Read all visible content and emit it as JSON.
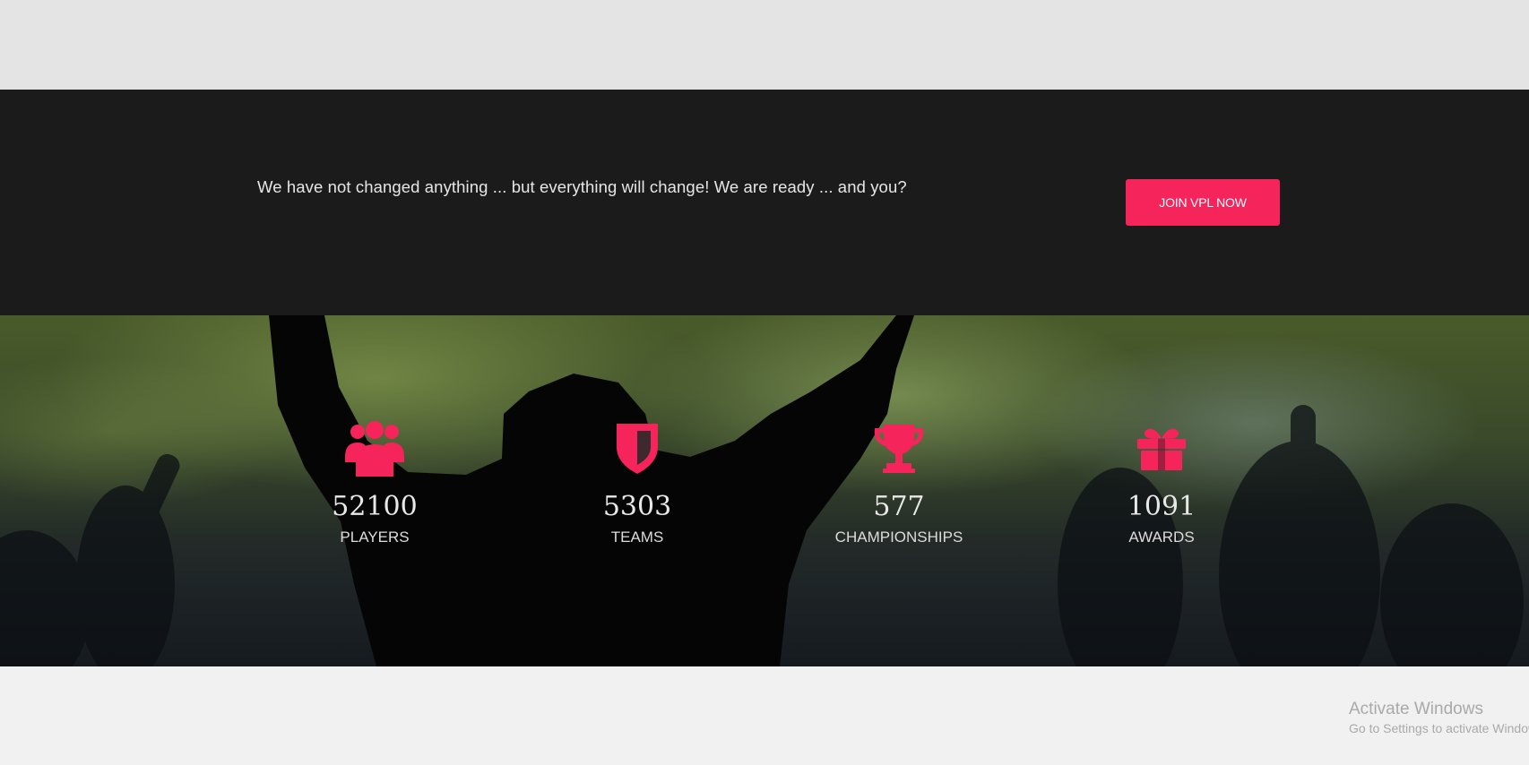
{
  "cta": {
    "text": "We have not changed anything ... but everything will change! We are ready ... and you?",
    "button_label": "JOIN VPL NOW"
  },
  "stats": [
    {
      "icon": "users-icon",
      "value": "52100",
      "label": "PLAYERS"
    },
    {
      "icon": "shield-icon",
      "value": "5303",
      "label": "TEAMS"
    },
    {
      "icon": "trophy-icon",
      "value": "577",
      "label": "CHAMPIONSHIPS"
    },
    {
      "icon": "gift-icon",
      "value": "1091",
      "label": "AWARDS"
    }
  ],
  "colors": {
    "accent": "#f5245a",
    "band": "#1b1b1b",
    "top_strip": "#e4e4e4",
    "footer": "#f1f1f1"
  },
  "watermark": {
    "title": "Activate Windows",
    "subtitle": "Go to Settings to activate Windows."
  }
}
